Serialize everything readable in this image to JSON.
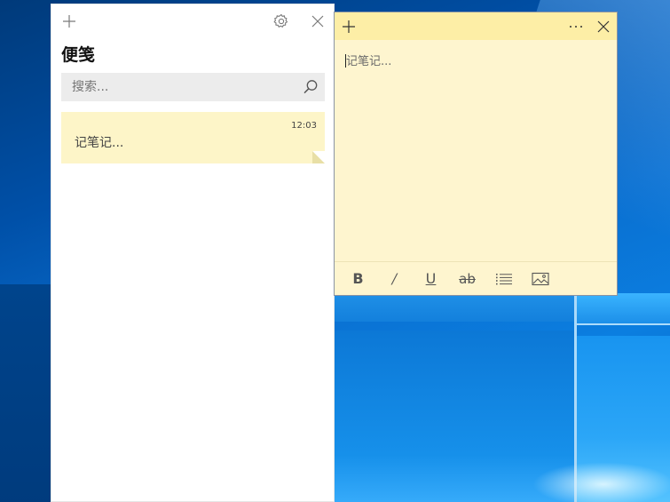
{
  "notes_list": {
    "heading": "便笺",
    "search_placeholder": "搜索...",
    "icons": {
      "add": "plus-icon",
      "settings": "gear-icon",
      "close": "close-icon",
      "search": "search-icon"
    },
    "notes": [
      {
        "time": "12:03",
        "text": "记笔记..."
      }
    ]
  },
  "sticky_note": {
    "placeholder": "记笔记...",
    "icons": {
      "add": "plus-icon",
      "more": "more-icon",
      "close": "close-icon"
    },
    "toolbar": {
      "bold": "B",
      "italic": "/",
      "underline": "U",
      "strikethrough": "ab",
      "bullets": "bullets-icon",
      "image": "image-icon"
    }
  },
  "colors": {
    "note_body": "#fef5cf",
    "note_titlebar": "#fdeea6",
    "card": "#fdf5c8",
    "search_bg": "#ececec"
  }
}
